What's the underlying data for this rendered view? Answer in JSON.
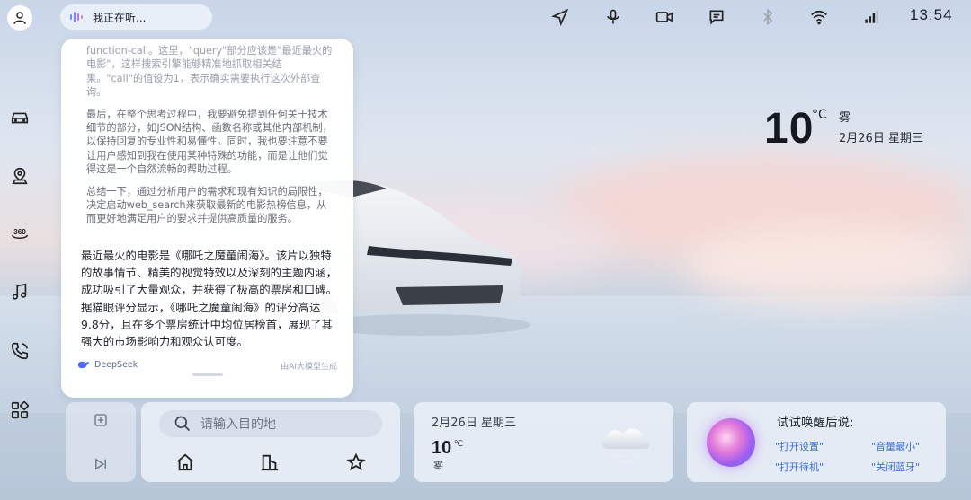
{
  "voice": {
    "status": "我正在听..."
  },
  "clock": "13:54",
  "weather": {
    "temp": "10",
    "unit": "°C",
    "condition": "雾",
    "date": "2月26日  星期三"
  },
  "chat": {
    "thinking": [
      "function-call。这里，\"query\"部分应该是\"最近最火的电影\"，这样搜索引擎能够精准地抓取相关结果。\"call\"的值设为1，表示确实需要执行这次外部查询。",
      "最后，在整个思考过程中，我要避免提到任何关于技术细节的部分，如JSON结构、函数名称或其他内部机制，以保持回复的专业性和易懂性。同时，我也要注意不要让用户感知到我在使用某种特殊的功能，而是让他们觉得这是一个自然流畅的帮助过程。",
      "总结一下，通过分析用户的需求和现有知识的局限性，决定启动web_search来获取最新的电影热榜信息，从而更好地满足用户的要求并提供高质量的服务。"
    ],
    "answer": "最近最火的电影是《哪吒之魔童闹海》。该片以独特的故事情节、精美的视觉特效以及深刻的主题内涵，成功吸引了大量观众，并获得了极高的票房和口碑。据猫眼评分显示，《哪吒之魔童闹海》的评分高达9.8分，且在多个票房统计中均位居榜首，展现了其强大的市场影响力和观众认可度。",
    "source": "DeepSeek",
    "generated_by": "由AI大模型生成"
  },
  "nav_widget": {
    "search_placeholder": "请输入目的地"
  },
  "weather_widget": {
    "date": "2月26日  星期三",
    "temp": "10",
    "unit": "℃",
    "condition": "雾"
  },
  "voice_widget": {
    "title": "试试唤醒后说:",
    "commands": [
      "\"打开设置\"",
      "\"音量最小\"",
      "\"打开待机\"",
      "\"关闭蓝牙\""
    ]
  },
  "icons": {
    "left_nav": [
      "user-icon",
      "car-icon",
      "location-icon",
      "360-view-icon",
      "music-icon",
      "phone-icon",
      "apps-icon"
    ],
    "status": [
      "navigation-icon",
      "microphone-icon",
      "camera-icon",
      "message-icon",
      "bluetooth-icon",
      "wifi-icon",
      "signal-icon"
    ]
  },
  "colors": {
    "accent": "#3b6fe0",
    "card": "#ffffff"
  }
}
